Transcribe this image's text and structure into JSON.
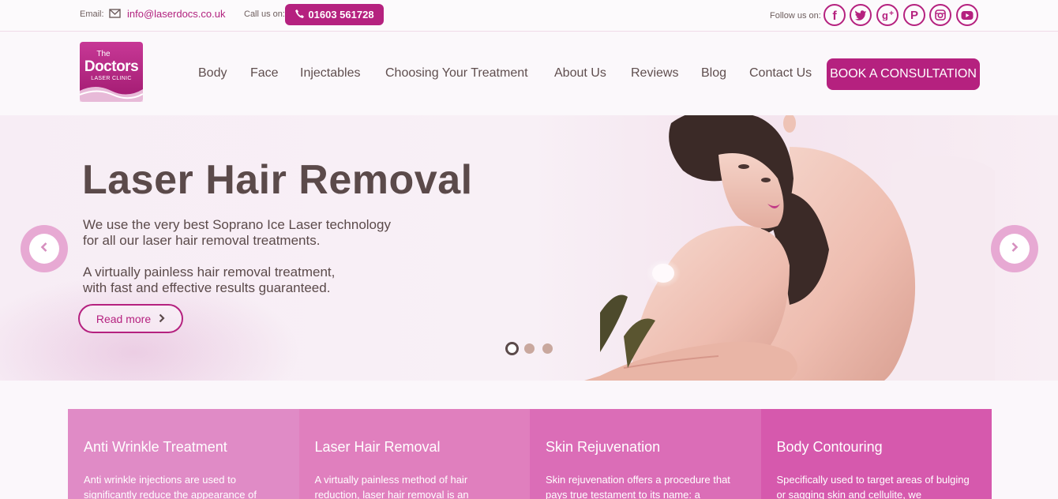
{
  "topbar": {
    "email_label": "Email:",
    "email": "info@laserdocs.co.uk",
    "call_label": "Call us on:",
    "phone": "01603 561728",
    "follow_label": "Follow us on:",
    "social": [
      "facebook-icon",
      "twitter-icon",
      "google-plus-icon",
      "pinterest-icon",
      "instagram-icon",
      "youtube-icon"
    ]
  },
  "logo": {
    "line1": "The",
    "line2": "Doctors",
    "line3": "LASER CLINIC"
  },
  "nav": {
    "items": [
      "Body",
      "Face",
      "Injectables",
      "Choosing Your Treatment",
      "About Us",
      "Reviews",
      "Blog",
      "Contact Us"
    ],
    "cta": "BOOK A CONSULTATION"
  },
  "hero": {
    "title": "Laser Hair Removal",
    "para1_line1": "We use the very best Soprano Ice Laser technology",
    "para1_line2": "for all our laser hair removal treatments.",
    "para2_line1": "A virtually painless hair removal treatment,",
    "para2_line2": "with fast and effective results guaranteed.",
    "button": "Read more",
    "slides": 3,
    "active_slide": 1
  },
  "cards": [
    {
      "title": "Anti Wrinkle Treatment",
      "text": "Anti wrinkle injections are used to significantly reduce the appearance of"
    },
    {
      "title": "Laser Hair Removal",
      "text": "A virtually painless method of hair reduction, laser hair removal is an"
    },
    {
      "title": "Skin Rejuvenation",
      "text": "Skin rejuvenation offers a procedure that pays true testament to its name: a"
    },
    {
      "title": "Body Contouring",
      "text": "Specifically used to target areas of bulging or sagging skin and cellulite, we"
    }
  ],
  "colors": {
    "brand": "#b5217f",
    "text": "#5b4a4a",
    "card1": "#e08bc6",
    "card2": "#e07fbe",
    "card3": "#db6db7",
    "card4": "#d659ad"
  }
}
